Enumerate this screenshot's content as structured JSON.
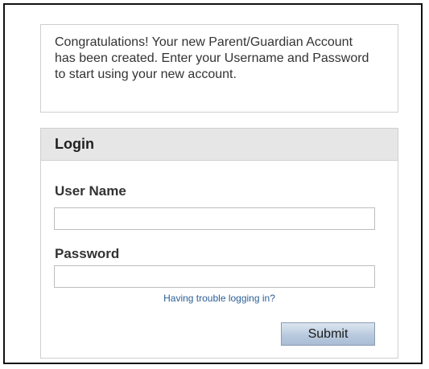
{
  "message": {
    "text": "Congratulations! Your new Parent/Guardian Account has been created. Enter your Username and Password to start using your new account."
  },
  "login": {
    "title": "Login",
    "username_label": "User Name",
    "username_value": "",
    "password_label": "Password",
    "password_value": "",
    "trouble_link": "Having trouble logging in?",
    "submit_label": "Submit"
  },
  "colors": {
    "header_bg": "#e6e6e6",
    "link": "#2c5f96",
    "button_gradient_top": "#dce6f1",
    "button_gradient_bottom": "#a9bdd5"
  }
}
